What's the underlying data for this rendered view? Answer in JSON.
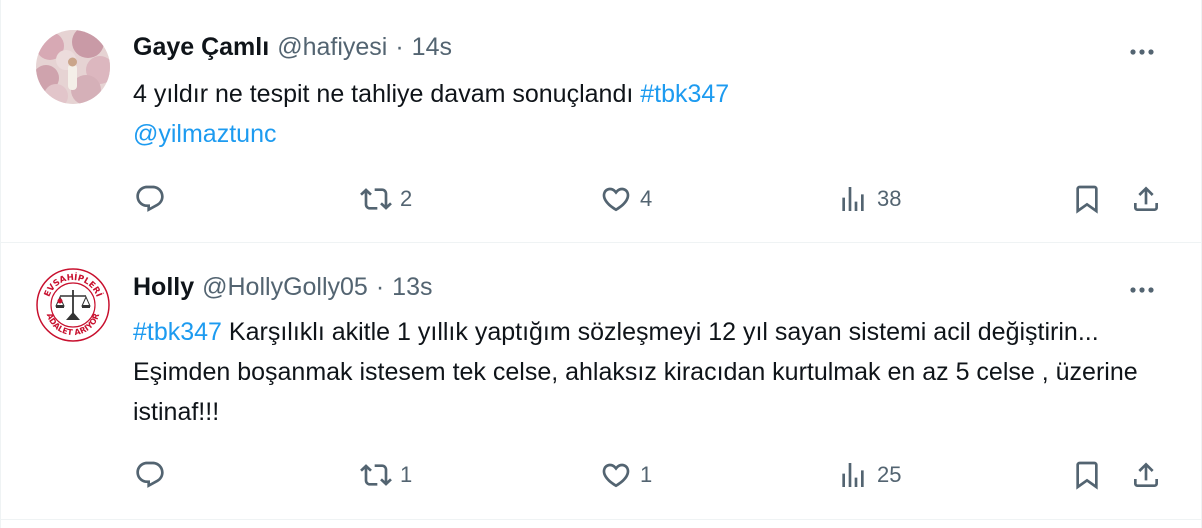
{
  "tweets": [
    {
      "name": "Gaye Çamlı",
      "handle": "@hafiyesi",
      "separator": "·",
      "time": "14s",
      "text_line1": "4 yıldır ne tespit ne tahliye davam sonuçlandı ",
      "hashtag": "#tbk347",
      "mention": "@yilmaztunc",
      "replies": "",
      "retweets": "2",
      "likes": "4",
      "views": "38",
      "avatar_colors": [
        "#d9b8c0",
        "#c7a4ad",
        "#e8d9d7"
      ]
    },
    {
      "name": "Holly",
      "handle": "@HollyGolly05",
      "separator": "·",
      "time": "13s",
      "hashtag": "#tbk347",
      "text": " Karşılıklı akitle 1 yıllık yaptığım sözleşmeyi 12 yıl sayan sistemi acil değiştirin... Eşimden boşanmak istesem tek celse, ahlaksız kiracıdan kurtulmak en az 5 celse , üzerine istinaf!!!",
      "replies": "",
      "retweets": "1",
      "likes": "1",
      "views": "25",
      "avatar_text_top": "EVSAHİPLERİ",
      "avatar_text_bottom": "ADALET ARIYOR",
      "avatar_colors": [
        "#c8102e",
        "#ffffff",
        "#333333"
      ]
    }
  ],
  "icons": {
    "reply": "reply-icon",
    "retweet": "retweet-icon",
    "like": "heart-icon",
    "views": "views-icon",
    "bookmark": "bookmark-icon",
    "share": "share-icon",
    "more": "more-icon"
  },
  "colors": {
    "link": "#1d9bf0",
    "secondary": "#536471",
    "text": "#0f1419",
    "divider": "#eff3f4"
  }
}
